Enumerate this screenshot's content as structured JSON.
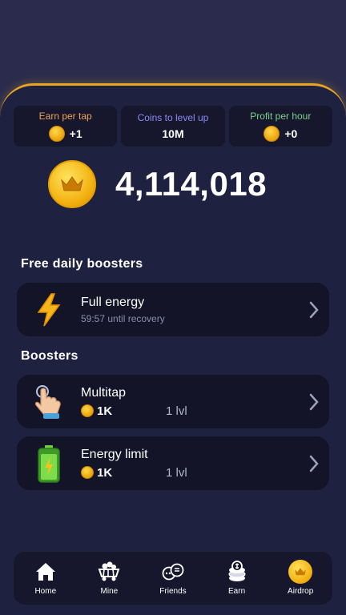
{
  "stats": [
    {
      "label": "Earn per tap",
      "value": "+1",
      "color": "#f0a25c",
      "coin": true
    },
    {
      "label": "Coins to level up",
      "value": "10M",
      "color": "#8a8cf5",
      "coin": false
    },
    {
      "label": "Profit per hour",
      "value": "+0",
      "color": "#7fd08a",
      "coin": true
    }
  ],
  "balance": "4,114,018",
  "free_boosters": {
    "title": "Free daily boosters",
    "items": [
      {
        "name": "Full energy",
        "subtitle": "59:57 until recovery",
        "icon": "lightning-icon"
      }
    ]
  },
  "boosters": {
    "title": "Boosters",
    "items": [
      {
        "name": "Multitap",
        "cost": "1K",
        "level": "1 lvl",
        "icon": "tap-hand-icon"
      },
      {
        "name": "Energy limit",
        "cost": "1K",
        "level": "1 lvl",
        "icon": "battery-icon"
      }
    ]
  },
  "nav": [
    {
      "label": "Home",
      "icon": "home-icon"
    },
    {
      "label": "Mine",
      "icon": "mine-cart-icon"
    },
    {
      "label": "Friends",
      "icon": "friends-icon"
    },
    {
      "label": "Earn",
      "icon": "coin-stack-icon"
    },
    {
      "label": "Airdrop",
      "icon": "airdrop-coin-icon"
    }
  ],
  "colors": {
    "accent": "#e8a621",
    "background": "#2b2c4d",
    "panel": "#1f2140",
    "card": "#131427"
  }
}
